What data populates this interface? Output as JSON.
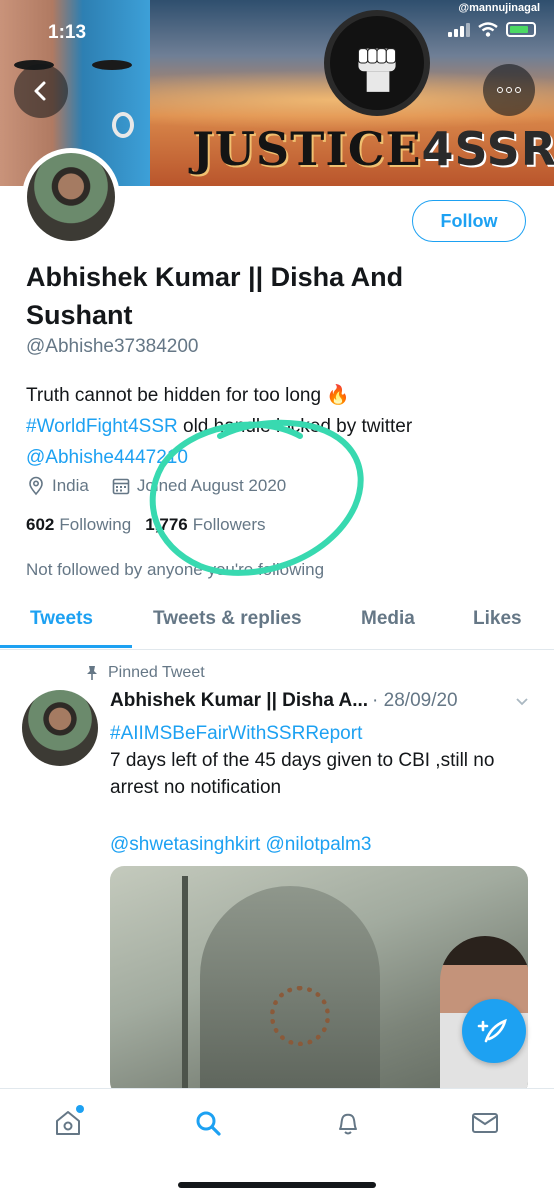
{
  "status_bar": {
    "time": "1:13"
  },
  "banner": {
    "watermark": "@mannujinagal",
    "text_justice": "JUSTICE",
    "text_number": "4SSR"
  },
  "profile": {
    "follow_label": "Follow",
    "name": "Abhishek Kumar || Disha And Sushant",
    "handle": "@Abhishe37384200",
    "bio_line1": "Truth cannot be hidden for too long 🔥",
    "bio_hashtag": "#WorldFight4SSR",
    "bio_line2_rest": " old handle locked by twitter",
    "bio_mention": "@Abhishe4447210",
    "location": "India",
    "joined": "Joined August 2020",
    "following_count": "602",
    "following_label": "Following",
    "followers_count": "1,776",
    "followers_label": "Followers",
    "not_followed": "Not followed by anyone you're following"
  },
  "tabs": [
    {
      "label": "Tweets",
      "active": true
    },
    {
      "label": "Tweets & replies",
      "active": false
    },
    {
      "label": "Media",
      "active": false
    },
    {
      "label": "Likes",
      "active": false
    }
  ],
  "tweet": {
    "pinned_label": "Pinned Tweet",
    "author": "Abhishek Kumar || Disha A...",
    "date": "· 28/09/20",
    "hashtag": "#AIIMSBeFairWithSSRReport",
    "text": "7 days left of the 45 days given to CBI ,still no arrest no notification",
    "mentions": "@shwetasinghkirt @nilotpalm3"
  },
  "colors": {
    "accent": "#1da1f2",
    "secondary_text": "#657786",
    "annotation": "#38d9b0"
  },
  "icons": [
    "back-arrow-icon",
    "more-icon",
    "location-icon",
    "calendar-icon",
    "pin-icon",
    "chevron-down-icon",
    "compose-icon",
    "home-icon",
    "search-icon",
    "notifications-icon",
    "messages-icon"
  ]
}
